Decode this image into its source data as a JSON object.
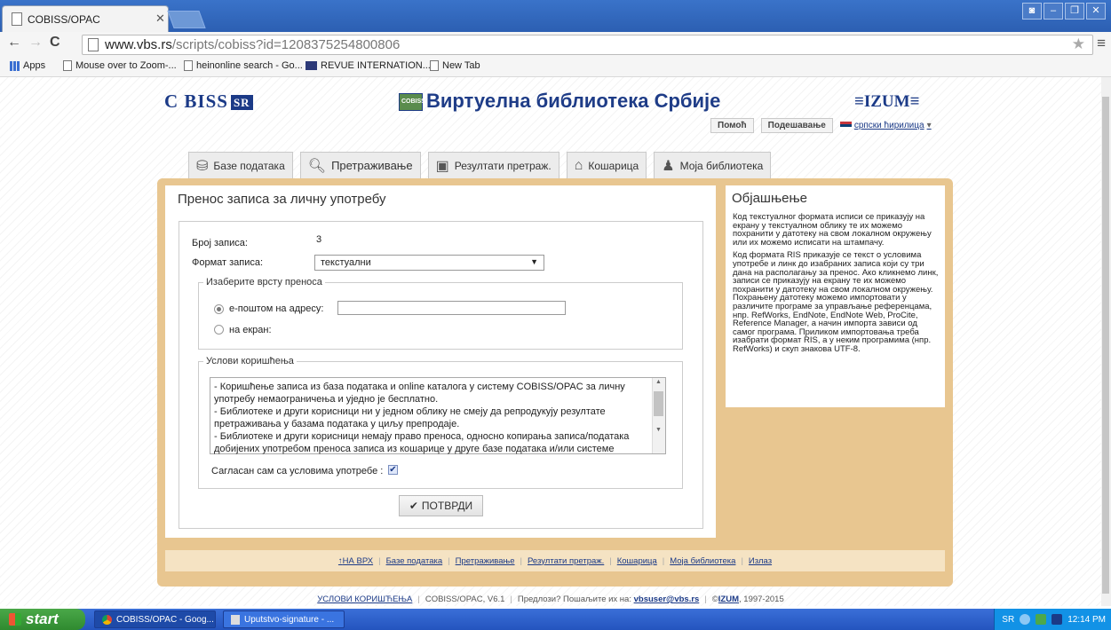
{
  "browser": {
    "tab_title": "COBISS/OPAC",
    "url_host": "www.vbs.rs",
    "url_path": "/scripts/cobiss?id=1208375254800806",
    "bookmarks": [
      "Apps",
      "Mouse over to Zoom-...",
      "heinonline search - Go...",
      "REVUE INTERNATION...",
      "New Tab"
    ]
  },
  "header": {
    "cobiss_logo": "C BISS",
    "cobiss_logo_tag": "SR",
    "site_title": "Виртуелна библиотека Србије",
    "izum_logo": "IZUM",
    "help_label": "Помоћ",
    "settings_label": "Подешавање",
    "language_label": "српски ћирилица"
  },
  "nav_tabs": [
    "Базе података",
    "Претраживање",
    "Резултати претраж.",
    "Кошарица",
    "Моја библиотека"
  ],
  "form": {
    "title": "Пренос записа за личну употребу",
    "records_label": "Број записа:",
    "records_value": "3",
    "format_label": "Формат записа:",
    "format_value": "текстуални",
    "transfer_legend": "Изаберите врсту преноса",
    "email_option": "е-поштом на адресу:",
    "email_value": "",
    "screen_option": "на екран:",
    "terms_legend": "Услови коришћења",
    "terms_text": "- Коришћење записа из база података и online каталога у систему COBISS/OPAC за личну употребу немаограничења и уједно је бесплатно.\n- Библиотеке и други корисници  ни у једном облику не смеју да репродукују резултате претраживања у базама података у циљу препродаје.\n- Библиотеке и други корисници немају право преноса, односно копирања записа/података добијених употребом преноса записа из кошарице у друге базе података и/или системе",
    "agree_label": "Сагласан сам са условима употребе :",
    "confirm_label": "ПОТВРДИ"
  },
  "explanation": {
    "title": "Објашњење",
    "para1": "Код текстуалног формата исписи се приказују на екрану у текстуалном облику те их можемо похранити у датотеку на свом локалном окружењу или их можемо исписати на штампачу.",
    "para2": "Код формата RIS приказује се текст о условима употребе и линк до изабраних записа који су три дана на располагању за пренос. Ако кликнемо линк, записи се приказују на екрану те их можемо похранити у датотеку на свом локалном окружењу. Похрањену датотеку можемо импортовати у различите програме за управљање референцама, нпр. RefWorks, EndNote, EndNote Web, ProCite, Reference Manager, а начин импорта зависи од самог програма. Приликом импортовања треба изабрати формат RIS, а у неким програмима (нпр. RefWorks) и скуп знакова UTF-8."
  },
  "footer_nav": [
    "НА ВРХ",
    "Базе података",
    "Претраживање",
    "Резултати претраж.",
    "Кошарица",
    "Моја библиотека",
    "Излаз"
  ],
  "credits": {
    "terms_link": "УСЛОВИ КОРИШЋЕЊА",
    "version": "COBISS/OPAC, V6.1",
    "suggestions": "Предлози? Пошаљите их на:",
    "email": "vbsuser@vbs.rs",
    "copyright_sign": "©",
    "izum": "IZUM",
    "years": ", 1997-2015"
  },
  "taskbar": {
    "start_label": "start",
    "tasks": [
      "COBISS/OPAC - Goog...",
      "Uputstvo-signature - ..."
    ],
    "lang": "SR",
    "clock": "12:14 PM"
  },
  "colors": {
    "accent_frame": "#e8c690",
    "brand_blue": "#1b3a87",
    "taskbar_blue": "#2454be"
  }
}
